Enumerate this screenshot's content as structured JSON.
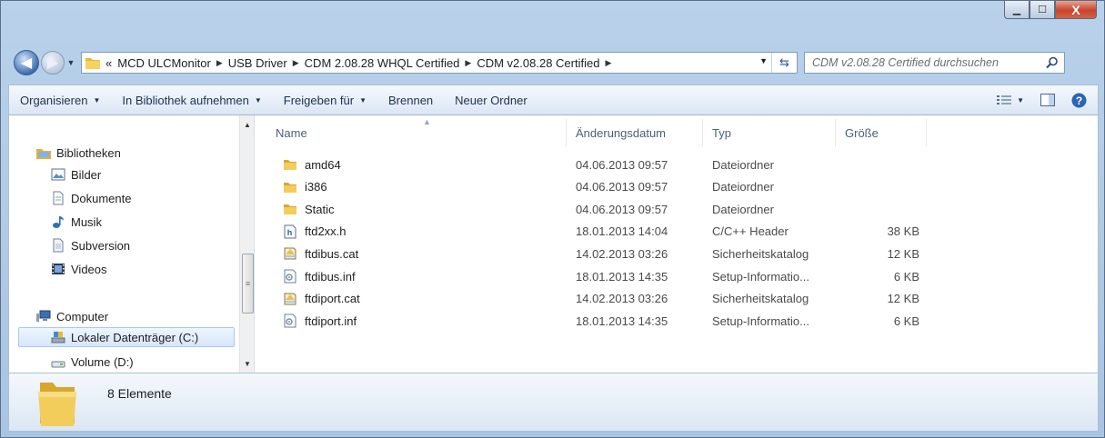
{
  "window": {
    "caption_buttons": [
      {
        "name": "minimize-icon"
      },
      {
        "name": "maximize-icon"
      },
      {
        "name": "close-icon",
        "glyph": "X"
      }
    ]
  },
  "address": {
    "overflow": "«",
    "breadcrumbs": [
      "MCD ULCMonitor",
      "USB Driver",
      "CDM 2.08.28 WHQL Certified",
      "CDM v2.08.28 Certified"
    ]
  },
  "search": {
    "placeholder": "CDM v2.08.28 Certified durchsuchen"
  },
  "toolbar": {
    "organize": "Organisieren",
    "include_library": "In Bibliothek aufnehmen",
    "share": "Freigeben für",
    "burn": "Brennen",
    "new_folder": "Neuer Ordner"
  },
  "nav": {
    "libraries": "Bibliotheken",
    "library_items": [
      "Bilder",
      "Dokumente",
      "Musik",
      "Subversion",
      "Videos"
    ],
    "computer": "Computer",
    "drives": [
      "Lokaler Datenträger (C:)",
      "Volume (D:)"
    ]
  },
  "columns": {
    "name": "Name",
    "date": "Änderungsdatum",
    "type": "Typ",
    "size": "Größe"
  },
  "files": [
    {
      "name": "amd64",
      "date": "04.06.2013 09:57",
      "type": "Dateiordner",
      "size": "",
      "icon": "folder-icon"
    },
    {
      "name": "i386",
      "date": "04.06.2013 09:57",
      "type": "Dateiordner",
      "size": "",
      "icon": "folder-icon"
    },
    {
      "name": "Static",
      "date": "04.06.2013 09:57",
      "type": "Dateiordner",
      "size": "",
      "icon": "folder-icon"
    },
    {
      "name": "ftd2xx.h",
      "date": "18.01.2013 14:04",
      "type": "C/C++ Header",
      "size": "38 KB",
      "icon": "header-file-icon"
    },
    {
      "name": "ftdibus.cat",
      "date": "14.02.2013 03:26",
      "type": "Sicherheitskatalog",
      "size": "12 KB",
      "icon": "catalog-file-icon"
    },
    {
      "name": "ftdibus.inf",
      "date": "18.01.2013 14:35",
      "type": "Setup-Informatio...",
      "size": "6 KB",
      "icon": "setup-info-file-icon"
    },
    {
      "name": "ftdiport.cat",
      "date": "14.02.2013 03:26",
      "type": "Sicherheitskatalog",
      "size": "12 KB",
      "icon": "catalog-file-icon"
    },
    {
      "name": "ftdiport.inf",
      "date": "18.01.2013 14:35",
      "type": "Setup-Informatio...",
      "size": "6 KB",
      "icon": "setup-info-file-icon"
    }
  ],
  "status": {
    "count_text": "8 Elemente"
  },
  "colors": {
    "chrome": "#b9d1ea",
    "toolbar": "#dbe6f4",
    "folder": "#f0c850",
    "selection": "#d6e7fb"
  }
}
